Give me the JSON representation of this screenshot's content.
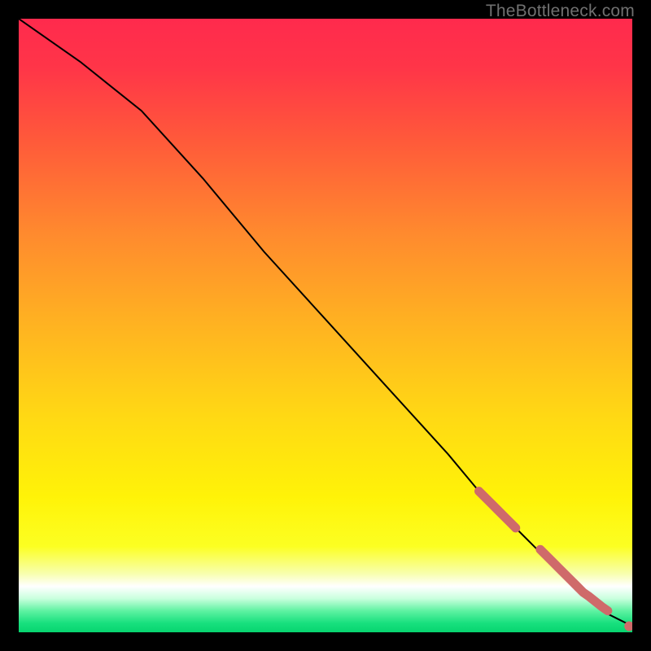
{
  "watermark": "TheBottleneck.com",
  "gradient": {
    "stops": [
      {
        "offset": 0.0,
        "color": "#ff2a4d"
      },
      {
        "offset": 0.08,
        "color": "#ff3548"
      },
      {
        "offset": 0.2,
        "color": "#ff5a3a"
      },
      {
        "offset": 0.35,
        "color": "#ff8a2e"
      },
      {
        "offset": 0.5,
        "color": "#ffb321"
      },
      {
        "offset": 0.65,
        "color": "#ffd914"
      },
      {
        "offset": 0.78,
        "color": "#fff308"
      },
      {
        "offset": 0.86,
        "color": "#fcff22"
      },
      {
        "offset": 0.905,
        "color": "#f8ffb0"
      },
      {
        "offset": 0.925,
        "color": "#ffffff"
      },
      {
        "offset": 0.945,
        "color": "#c9ffde"
      },
      {
        "offset": 0.965,
        "color": "#5ff2a2"
      },
      {
        "offset": 0.985,
        "color": "#18e07e"
      },
      {
        "offset": 1.0,
        "color": "#07d46f"
      }
    ]
  },
  "marker_color": "#cf6a6a",
  "line_color": "#000000",
  "chart_data": {
    "type": "line",
    "title": "",
    "xlabel": "",
    "ylabel": "",
    "xlim": [
      0,
      100
    ],
    "ylim": [
      0,
      100
    ],
    "series": [
      {
        "name": "curve",
        "x": [
          0,
          10,
          20,
          30,
          40,
          50,
          60,
          70,
          75,
          80,
          82,
          84,
          86,
          88,
          90,
          92,
          94,
          96,
          98,
          100
        ],
        "y": [
          100,
          93,
          85,
          74,
          62,
          51,
          40,
          29,
          23,
          18,
          16,
          14,
          12,
          10,
          8,
          6,
          5,
          3,
          2,
          1
        ]
      }
    ],
    "markers": {
      "name": "highlight-points",
      "x": [
        75,
        76,
        77,
        78,
        79,
        80,
        81,
        83,
        85,
        86,
        87,
        88,
        89,
        90,
        91,
        92,
        93,
        94,
        95,
        96,
        99.5
      ],
      "y": [
        23,
        22,
        21,
        20,
        19,
        18,
        17,
        15,
        13.5,
        12.5,
        11.5,
        10.5,
        9.5,
        8.5,
        7.5,
        6.5,
        5.8,
        5.0,
        4.2,
        3.5,
        1.0
      ]
    }
  }
}
